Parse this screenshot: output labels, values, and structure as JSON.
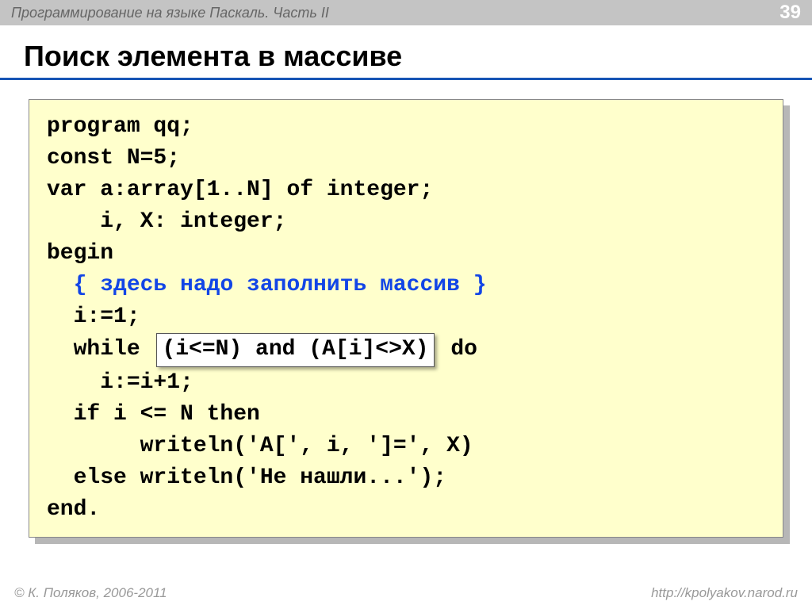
{
  "header": {
    "subject": "Программирование на языке Паскаль. Часть II",
    "page": "39"
  },
  "title": "Поиск элемента в массиве",
  "code": {
    "l1": "program qq;",
    "l2": "const N=5;",
    "l3": "var a:array[1..N] of integer;",
    "l4": "    i, X: integer;",
    "l5": "begin",
    "l6_pre": "  ",
    "l6": "{ здесь надо заполнить массив }",
    "l7": "  i:=1;",
    "l8_pre": "  while",
    "l8_hl": "(i<=N) and (A[i]<>X)",
    "l8_post": "do",
    "l9": "    i:=i+1;",
    "l10": "  if i <= N then",
    "l11": "       writeln('A[', i, ']=', X)",
    "l12": "  else writeln('Не нашли...');",
    "l13": "end."
  },
  "footer": {
    "copyright": "© К. Поляков, 2006-2011",
    "url": "http://kpolyakov.narod.ru"
  }
}
